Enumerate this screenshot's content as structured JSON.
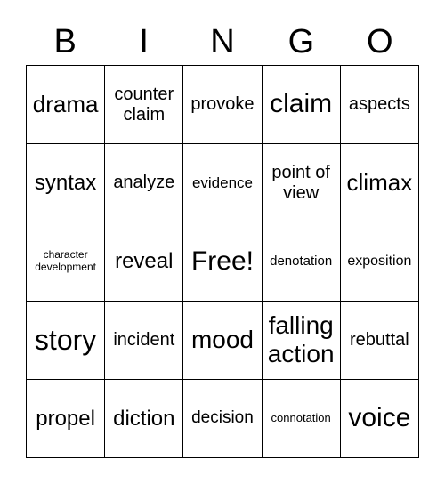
{
  "header": [
    "B",
    "I",
    "N",
    "G",
    "O"
  ],
  "cells": [
    [
      {
        "text": "drama",
        "size": 26
      },
      {
        "text": "counter claim",
        "size": 20
      },
      {
        "text": "provoke",
        "size": 20
      },
      {
        "text": "claim",
        "size": 30
      },
      {
        "text": "aspects",
        "size": 20
      }
    ],
    [
      {
        "text": "syntax",
        "size": 24
      },
      {
        "text": "analyze",
        "size": 20
      },
      {
        "text": "evidence",
        "size": 17
      },
      {
        "text": "point of view",
        "size": 20
      },
      {
        "text": "climax",
        "size": 26
      }
    ],
    [
      {
        "text": "character development",
        "size": 12
      },
      {
        "text": "reveal",
        "size": 24
      },
      {
        "text": "Free!",
        "size": 30
      },
      {
        "text": "denotation",
        "size": 15
      },
      {
        "text": "exposition",
        "size": 16
      }
    ],
    [
      {
        "text": "story",
        "size": 32
      },
      {
        "text": "incident",
        "size": 20
      },
      {
        "text": "mood",
        "size": 28
      },
      {
        "text": "falling action",
        "size": 28
      },
      {
        "text": "rebuttal",
        "size": 20
      }
    ],
    [
      {
        "text": "propel",
        "size": 24
      },
      {
        "text": "diction",
        "size": 24
      },
      {
        "text": "decision",
        "size": 19
      },
      {
        "text": "connotation",
        "size": 13
      },
      {
        "text": "voice",
        "size": 30
      }
    ]
  ]
}
